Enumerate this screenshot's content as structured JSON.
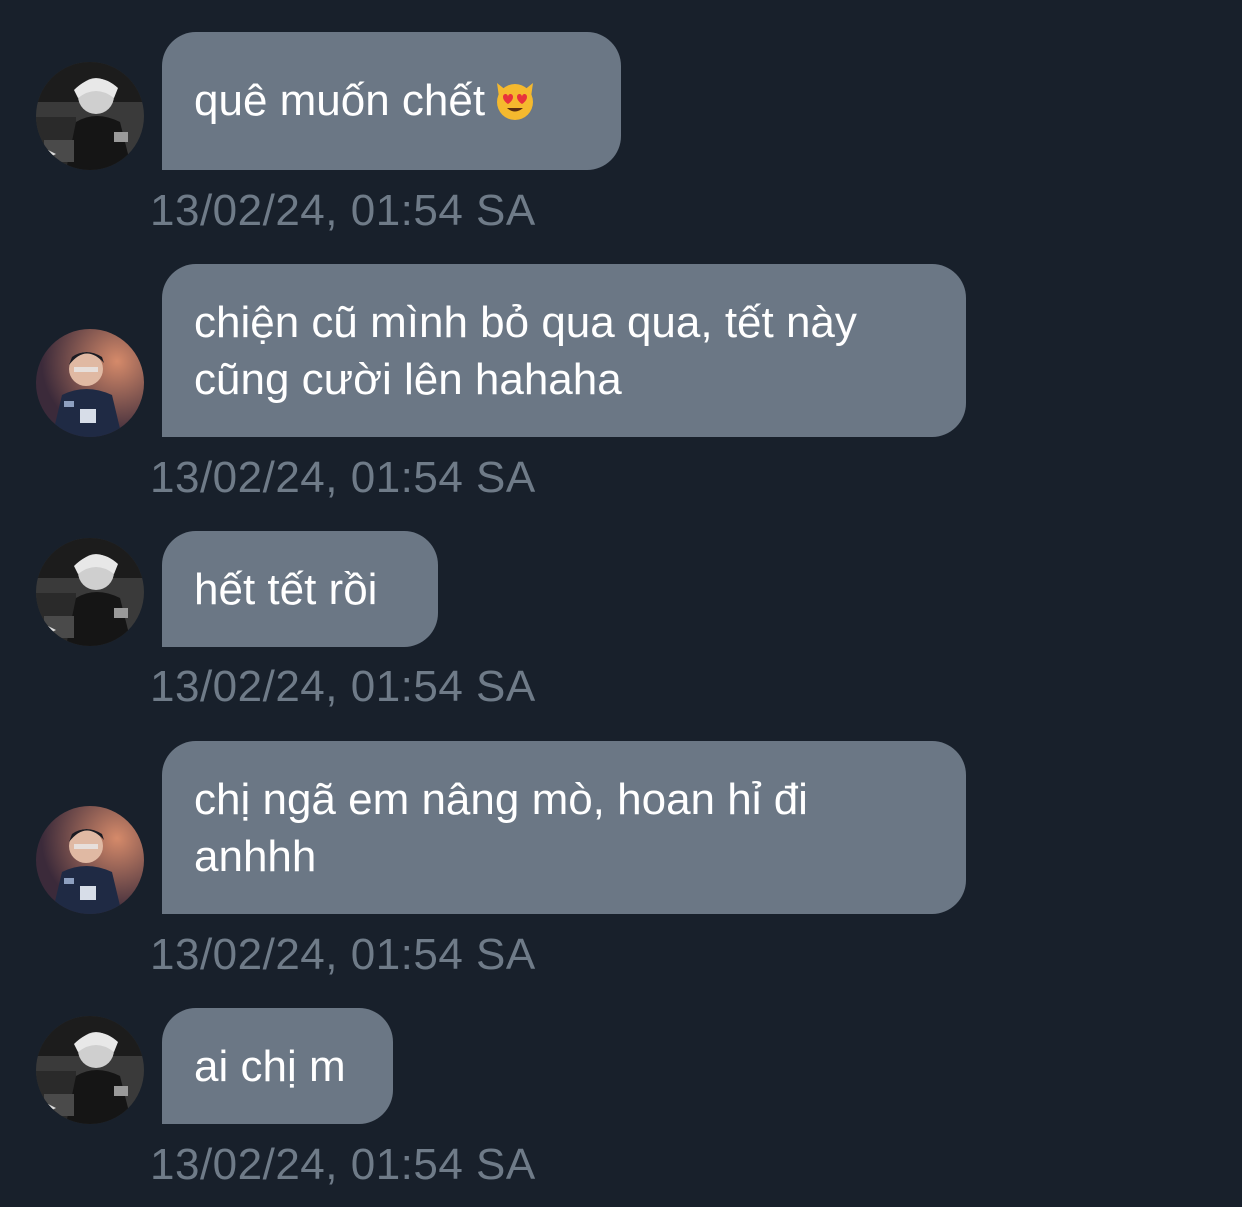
{
  "messages": [
    {
      "avatar": "avatar-grayscale-player",
      "text": "quê muốn chết",
      "emoji": "heart-eyes-cat-icon",
      "time": "13/02/24, 01:54 SA"
    },
    {
      "avatar": "avatar-color-player",
      "text": "chiện cũ mình bỏ qua qua, tết này cũng cười lên hahaha",
      "time": "13/02/24, 01:54 SA"
    },
    {
      "avatar": "avatar-grayscale-player",
      "text": "hết tết rồi",
      "time": "13/02/24, 01:54 SA"
    },
    {
      "avatar": "avatar-color-player",
      "text": "chị ngã em nâng mò, hoan hỉ đi anhhh",
      "time": "13/02/24, 01:54 SA"
    },
    {
      "avatar": "avatar-grayscale-player",
      "text": "ai chị m",
      "time": "13/02/24, 01:54 SA"
    }
  ],
  "colors": {
    "background": "#18202b",
    "bubble": "#6b7785",
    "timestamp": "#6f7b88",
    "text": "#ffffff"
  }
}
